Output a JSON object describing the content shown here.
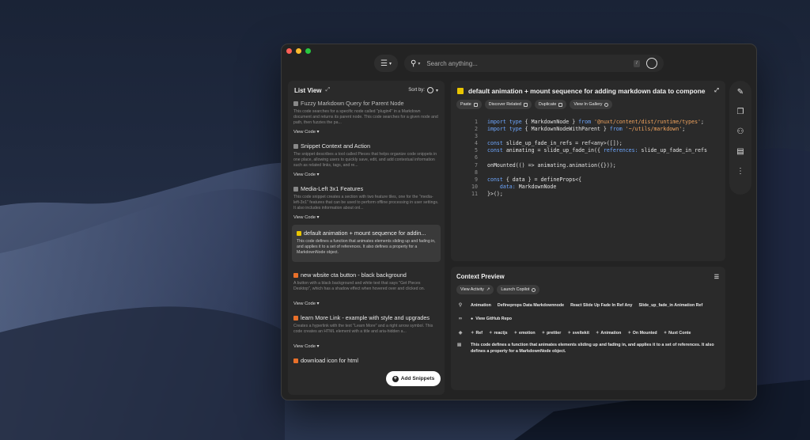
{
  "search": {
    "placeholder": "Search anything..."
  },
  "list_panel": {
    "title": "List View",
    "sort_label": "Sort by:",
    "add_button_label": "Add Snippets",
    "snippets": [
      {
        "title": "Fuzzy Markdown Query for Parent Node",
        "desc": "This code searches for a specific node called \"plugin4\" in a Markdown document and returns its parent node. This code searches for a given node and path, then fuzzies the pa...",
        "view": "View Code",
        "icon": "gray"
      },
      {
        "title": "Snippet Context and Action",
        "desc": "The snippet describes a tool called Pieces that helps organize code snippets in one place, allowing users to quickly save, edit, and add contextual information such as related links, tags, and re...",
        "view": "View Code",
        "icon": "gray"
      },
      {
        "title": "Media-Left 3x1 Features",
        "desc": "This code snippet creates a section with two feature tiles, one for the \"media-left-3x1\" features that can be used to perform offline processing in user settings. It also includes information about onl...",
        "view": "View Code",
        "icon": "gray"
      },
      {
        "title": "default animation + mount sequence for addin...",
        "desc": "This code defines a function that animates elements sliding up and fading in, and applies it to a set of references. It also defines a property for a MarkdownNode object.",
        "view": "",
        "icon": "yellow"
      },
      {
        "title": "new wbsite cta button - black background",
        "desc": "A button with a black background and white text that says \"Get Pieces Desktop\", which has a shadow effect when hovered over and clicked on.",
        "view": "View Code",
        "icon": "orange"
      },
      {
        "title": "learn More Link - example with style and upgrades",
        "desc": "Creates a hyperlink with the text \"Learn More\" and a right arrow symbol. This code creates an HTML element with a title and aria-hidden a...",
        "view": "View Code",
        "icon": "orange"
      },
      {
        "title": "download icon for html",
        "desc": "",
        "view": "",
        "icon": "orange"
      }
    ]
  },
  "code_panel": {
    "title": "default animation + mount sequence for adding markdown data to components i",
    "chips": [
      "Paste",
      "Discover Related",
      "Duplicate",
      "View In Gallery"
    ],
    "lines": [
      "import type { MarkdownNode } from '@nuxt/content/dist/runtime/types';",
      "import type { MarkdownNodeWithParent } from '~/utils/markdown';",
      "",
      "const slide_up_fade_in_refs = ref<any>([]);",
      "const animating = slide_up_fade_in({ references: slide_up_fade_in_refs",
      "",
      "onMounted(() => animating.animation({}));",
      "",
      "const { data } = defineProps<{",
      "    data: MarkdownNode",
      "}>();"
    ]
  },
  "context_panel": {
    "title": "Context Preview",
    "chips": [
      "View Activity",
      "Launch Copilot"
    ],
    "related": [
      "Animation",
      "Defineprops Data Markdownnode",
      "React Slide Up Fade In Ref Any",
      "Slide_up_fade_in Animation Ref"
    ],
    "github_label": "View GitHub Repo",
    "tags": [
      "Ref",
      "reactjs",
      "emotion",
      "prettier",
      "sveltekit",
      "Animation",
      "On Mounted",
      "Nuxt Conte"
    ],
    "description": "This code defines a function that animates elements sliding up and fading in, and applies it to a set of references. It also defines a property for a MarkdownNode object."
  },
  "colors": {
    "accent_yellow": "#e9c500",
    "accent_orange": "#e8702a",
    "panel": "#2a2a2a"
  }
}
